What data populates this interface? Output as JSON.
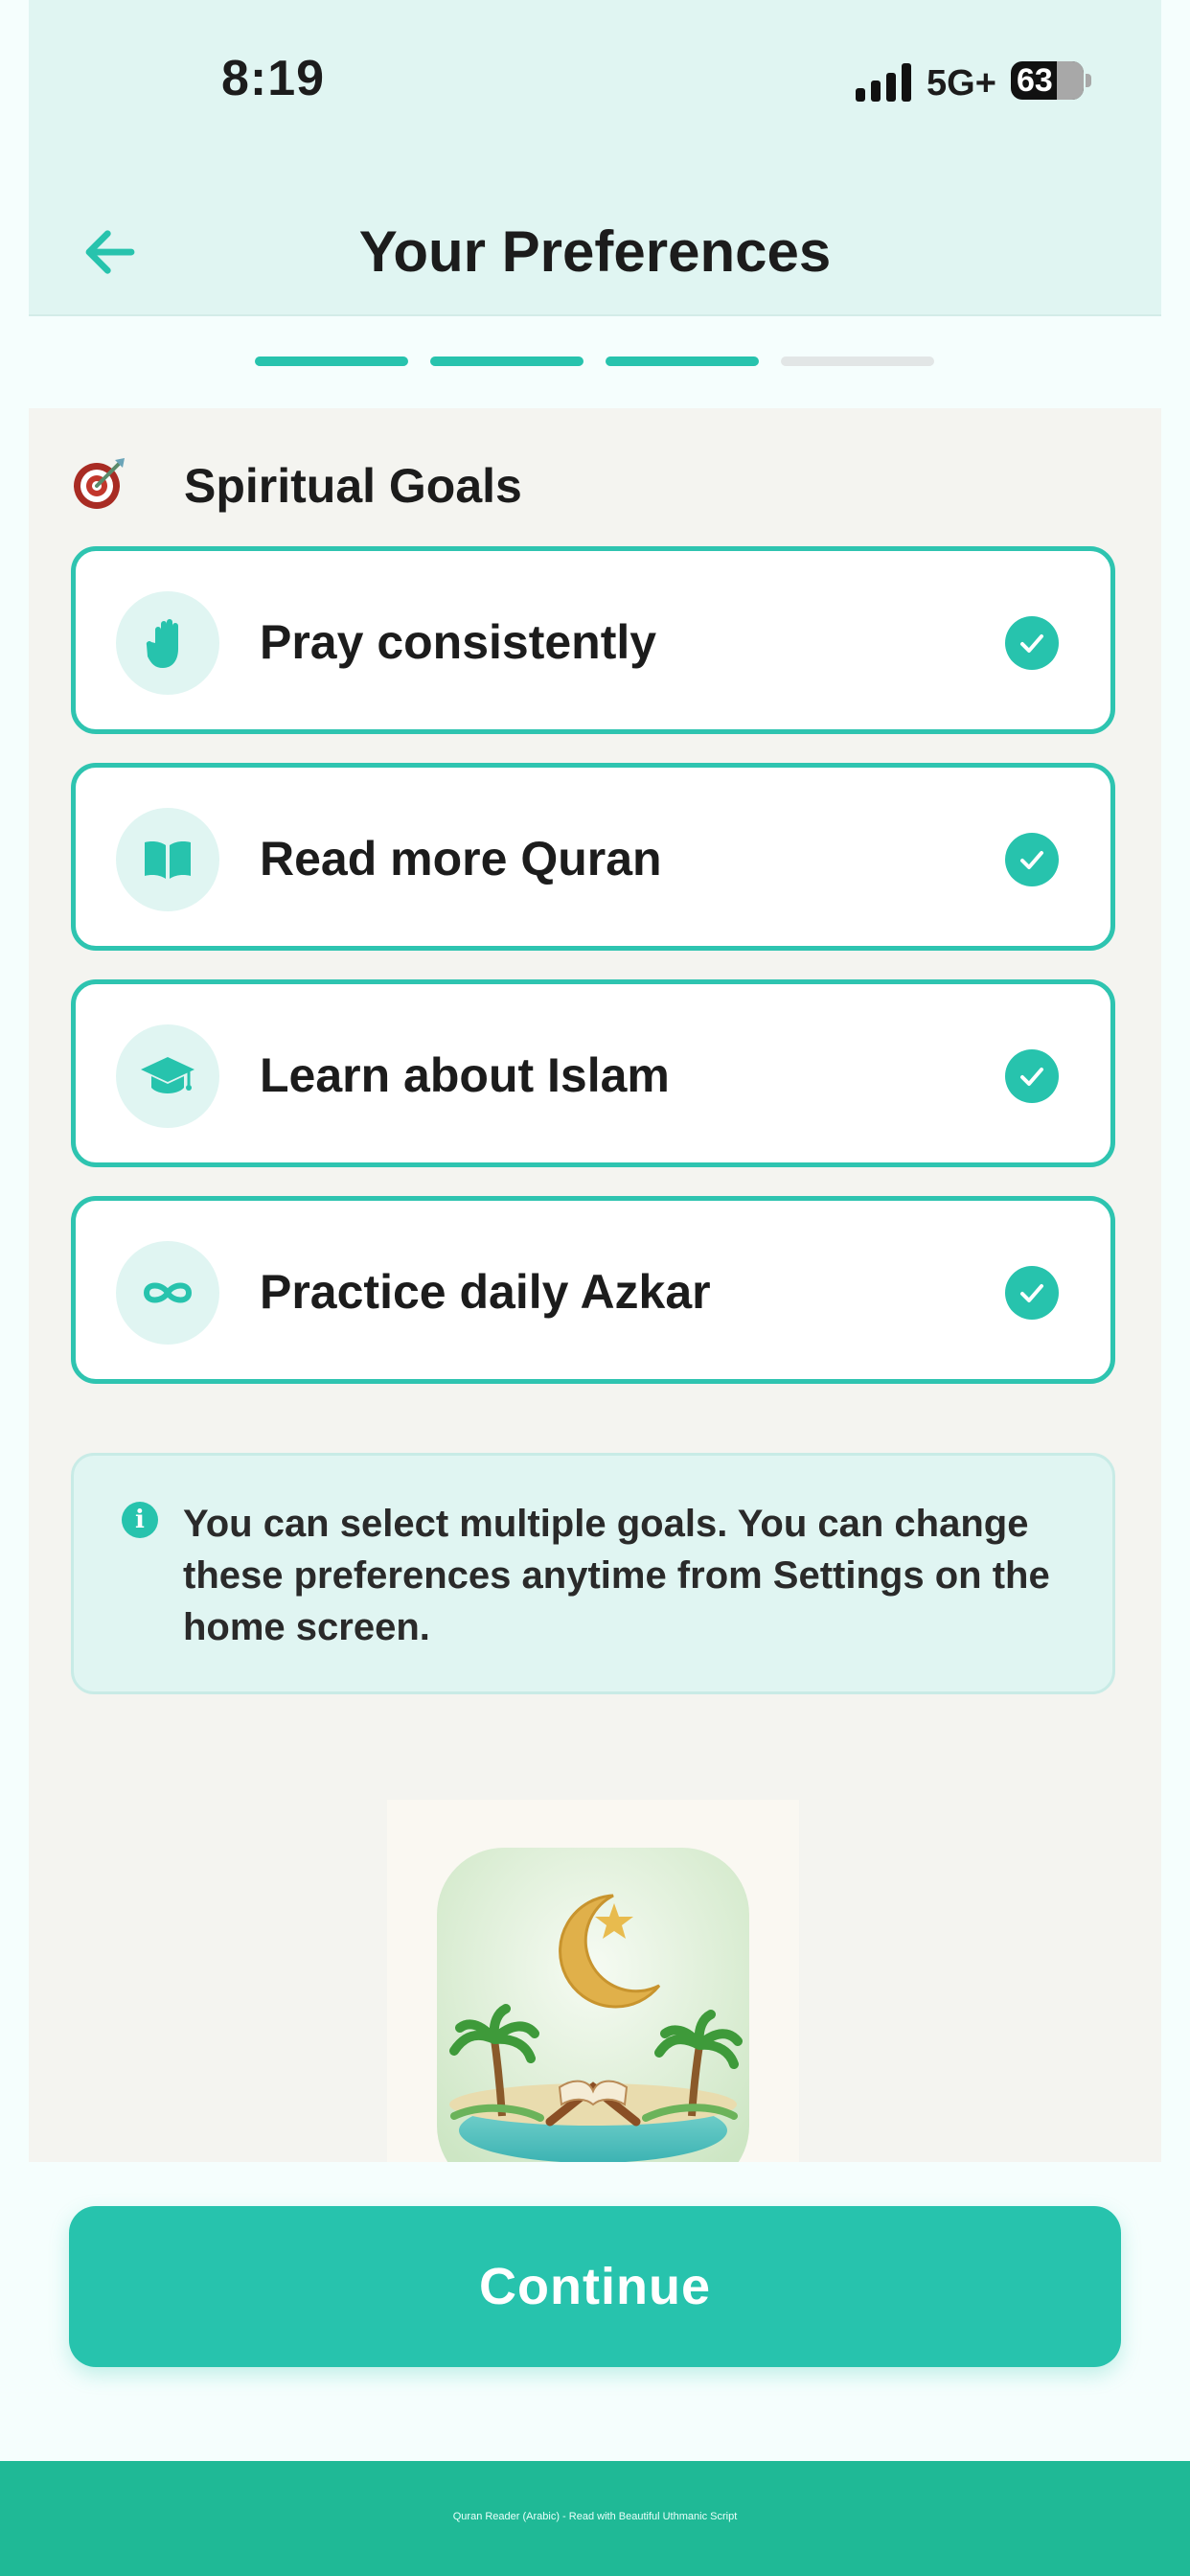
{
  "status_bar": {
    "time": "8:19",
    "network": "5G+",
    "battery": "63"
  },
  "header": {
    "title": "Your Preferences",
    "back_icon": "arrow-left-icon"
  },
  "progress": {
    "total_steps": 4,
    "completed_steps": 3,
    "active_color": "#27c3ad",
    "inactive_color": "#e2e6e6"
  },
  "section": {
    "icon": "target-icon",
    "title": "Spiritual Goals"
  },
  "goals": [
    {
      "label": "Pray consistently",
      "icon": "hand-icon",
      "selected": true
    },
    {
      "label": "Read more Quran",
      "icon": "book-icon",
      "selected": true
    },
    {
      "label": "Learn about Islam",
      "icon": "graduation-cap-icon",
      "selected": true
    },
    {
      "label": "Practice daily Azkar",
      "icon": "infinity-icon",
      "selected": true
    }
  ],
  "info": {
    "icon": "info-icon",
    "text": "You can select multiple goals. You can change these preferences anytime from Settings on the home screen."
  },
  "illustration": {
    "name": "app-illustration",
    "description_icon": "crescent-quran-oasis-icon"
  },
  "continue_button": {
    "label": "Continue"
  },
  "footer": {
    "text": "Quran Reader (Arabic) - Read with Beautiful Uthmanic Script"
  },
  "colors": {
    "accent": "#27c3ad",
    "header_bg": "#e0f5f2",
    "footer_bg": "#1fb996"
  }
}
